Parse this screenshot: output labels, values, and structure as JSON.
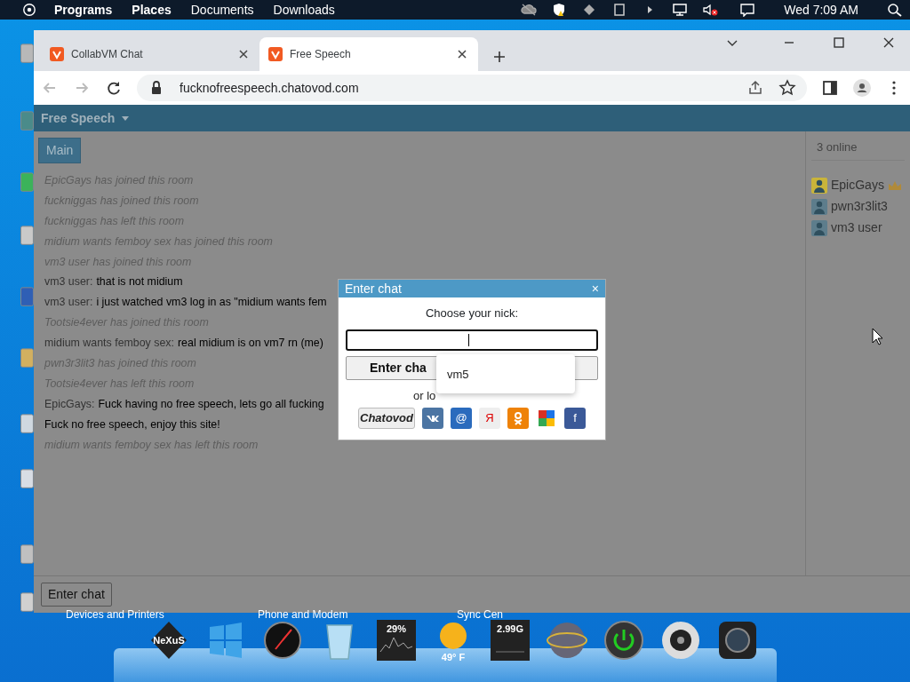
{
  "top_panel": {
    "menus": [
      {
        "label": "Programs",
        "bold": true
      },
      {
        "label": "Places",
        "bold": true
      },
      {
        "label": "Documents",
        "bold": false
      },
      {
        "label": "Downloads",
        "bold": false
      }
    ],
    "clock": "Wed 7:09 AM"
  },
  "browser": {
    "tabs": [
      {
        "title": "CollabVM Chat",
        "selected": false
      },
      {
        "title": "Free Speech",
        "selected": true
      }
    ],
    "url": "fucknofreespeech.chatovod.com"
  },
  "chat": {
    "room_title": "Free Speech",
    "room_tabs": [
      {
        "label": "Main",
        "selected": true
      }
    ],
    "messages": [
      {
        "kind": "event",
        "text": "EpicGays has joined this room"
      },
      {
        "kind": "event",
        "text": "fuckniggas has joined this room"
      },
      {
        "kind": "event",
        "text": "fuckniggas has left this room"
      },
      {
        "kind": "event",
        "text": "midium wants femboy sex has joined this room"
      },
      {
        "kind": "event",
        "text": "vm3 user has joined this room"
      },
      {
        "kind": "message",
        "author": "vm3 user:",
        "text": "that is not midium"
      },
      {
        "kind": "message",
        "author": "vm3 user:",
        "text": "i just watched vm3 log in as \"midium wants fem"
      },
      {
        "kind": "event",
        "text": "Tootsie4ever has joined this room"
      },
      {
        "kind": "message",
        "author": "midium wants femboy sex:",
        "text": "real midium is on vm7 rn (me)"
      },
      {
        "kind": "event",
        "text": "pwn3r3lit3 has joined this room"
      },
      {
        "kind": "event",
        "text": "Tootsie4ever has left this room"
      },
      {
        "kind": "message",
        "author": "EpicGays:",
        "text": "Fuck having no free speech, lets go all fucking"
      },
      {
        "kind": "notice",
        "text": "Fuck no free speech, enjoy this site!"
      },
      {
        "kind": "event",
        "text": "midium wants femboy sex has left this room"
      }
    ],
    "online_count": "3 online",
    "users": [
      {
        "name": "EpicGays",
        "color": "#c9b43a",
        "moderator": true
      },
      {
        "name": "pwn3r3lit3",
        "color": "#5d7d8c",
        "moderator": false
      },
      {
        "name": "vm3 user",
        "color": "#5d7d8c",
        "moderator": false
      }
    ],
    "enter_button": "Enter chat"
  },
  "dialog": {
    "title": "Enter chat",
    "close": "×",
    "prompt": "Choose your nick:",
    "submit": "Enter cha",
    "alt_login": "or lo",
    "providers": [
      {
        "kind": "chatovod",
        "label": "Chatovod"
      },
      {
        "kind": "vk"
      },
      {
        "kind": "mail",
        "label": "@"
      },
      {
        "kind": "yandex",
        "label": "Я"
      },
      {
        "kind": "ok"
      },
      {
        "kind": "google"
      },
      {
        "kind": "facebook",
        "label": "f"
      }
    ],
    "suggestions": [
      "vm5"
    ]
  },
  "desktop": {
    "labels": [
      "Devices and Printers",
      "Phone and Modem",
      "Sync Cen"
    ]
  },
  "dock": [
    {
      "kind": "logo",
      "label": "NeXuS"
    },
    {
      "kind": "windows"
    },
    {
      "kind": "clock"
    },
    {
      "kind": "recycle"
    },
    {
      "kind": "cpu",
      "label": "29%"
    },
    {
      "kind": "weather",
      "label": "49° F"
    },
    {
      "kind": "memory",
      "label": "2.99G"
    },
    {
      "kind": "globe"
    },
    {
      "kind": "power"
    },
    {
      "kind": "speaker"
    },
    {
      "kind": "camera"
    }
  ]
}
